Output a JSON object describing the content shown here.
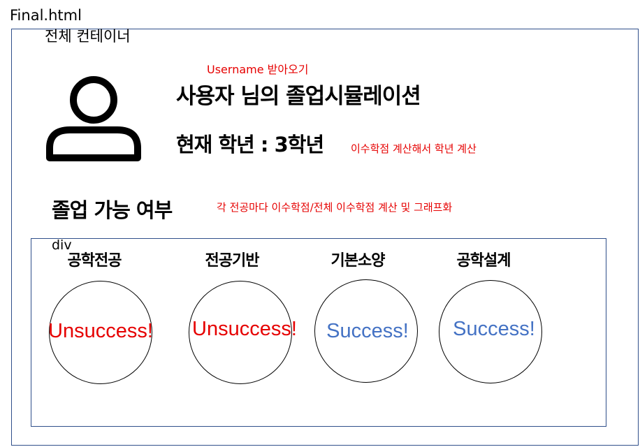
{
  "file_name": "Final.html",
  "outer_container_label": "전체 컨테이너",
  "inner_container_label": "div",
  "colors": {
    "annotation": "#e60000",
    "unsuccess": "#e60000",
    "success": "#4472c4",
    "box_border": "#2f4f8a"
  },
  "header": {
    "avatar_icon": "user-icon",
    "title": "사용자 님의 졸업시뮬레이션",
    "grade_text": "현재 학년 : 3학년"
  },
  "annotations": {
    "username": "Username 받아오기",
    "grade_calc": "이수학점 계산해서 학년 계산",
    "graph_calc": "각 전공마다 이수학점/전체 이수학점 계산 및 그래프화"
  },
  "graduation": {
    "title": "졸업 가능 여부",
    "categories": [
      {
        "label": "공학전공",
        "status": "Unsuccess!",
        "status_type": "unsuccess"
      },
      {
        "label": "전공기반",
        "status": "Unsuccess!",
        "status_type": "unsuccess"
      },
      {
        "label": "기본소양",
        "status": "Success!",
        "status_type": "success"
      },
      {
        "label": "공학설계",
        "status": "Success!",
        "status_type": "success"
      }
    ]
  }
}
